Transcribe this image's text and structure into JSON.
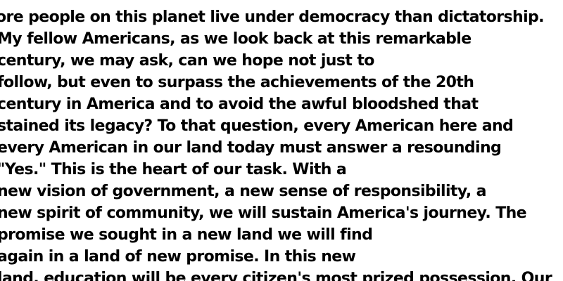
{
  "document": {
    "lines": [
      "ore people on this planet live under democracy than dictatorship.",
      "My fellow Americans, as we look back at this remarkable",
      "century, we may ask, can we hope not just to",
      "follow, but even to surpass the achievements of the 20th",
      "century in America and to avoid the awful bloodshed that",
      "stained its legacy? To that question, every American here and",
      "every American in our land today must answer a resounding",
      "\"Yes.\" This is the heart of our task. With a",
      "new vision of government, a new sense of responsibility, a",
      "new spirit of community, we will sustain America's journey. The",
      "promise we sought in a new land we will find",
      "again in a land of new promise. In this new",
      "land, education will be every citizen's most prized possession. Our"
    ]
  }
}
